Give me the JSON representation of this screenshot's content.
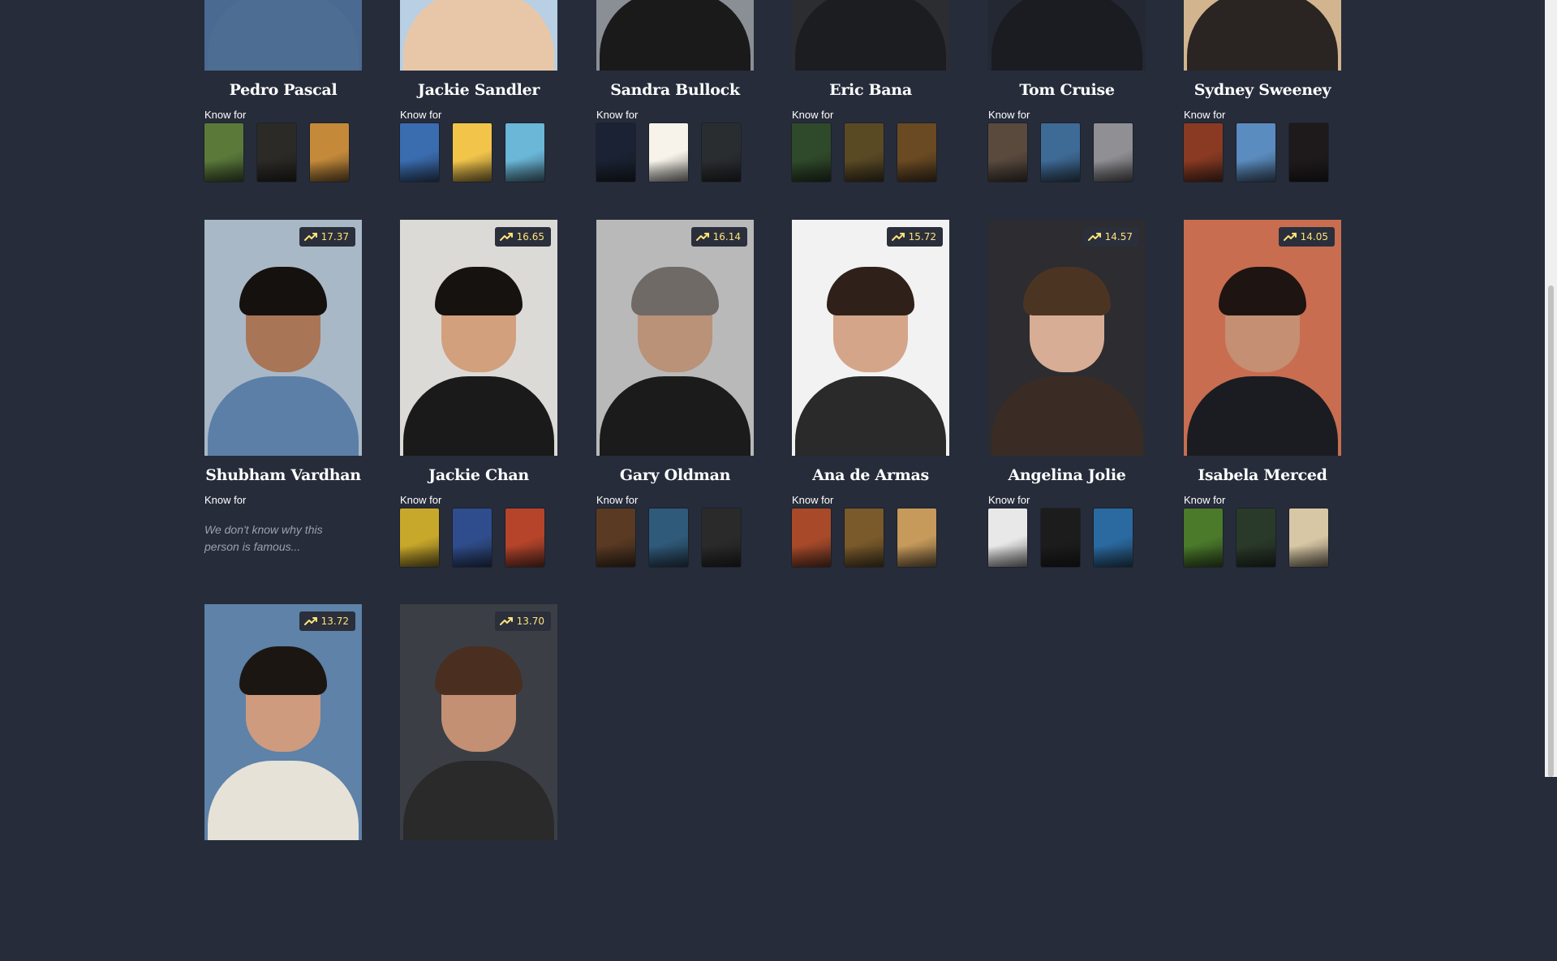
{
  "known_for_label": "Know for",
  "no_known_text": "We don't know why this person is famous...",
  "people": [
    {
      "name": "Pedro Pascal",
      "popularity": null,
      "photo": {
        "bg": "#4a6a92",
        "skin": "#c99a7b",
        "hair": "#1f1b18",
        "body": "#4d6d93"
      },
      "posters": [
        "#5b7a3a",
        "#2b2a26",
        "#c48a3a"
      ]
    },
    {
      "name": "Jackie Sandler",
      "popularity": null,
      "photo": {
        "bg": "#b8cfe4",
        "skin": "#e2b192",
        "hair": "#c6a27a",
        "body": "#e8c7a9"
      },
      "posters": [
        "#3a6cb0",
        "#f2c54a",
        "#6ab7d8"
      ]
    },
    {
      "name": "Sandra Bullock",
      "popularity": null,
      "photo": {
        "bg": "#8a8f95",
        "skin": "#d7ab8f",
        "hair": "#3e2a1e",
        "body": "#1a1a1a"
      },
      "posters": [
        "#1a2233",
        "#f7f3ea",
        "#2a2d30"
      ]
    },
    {
      "name": "Eric Bana",
      "popularity": null,
      "photo": {
        "bg": "#2b2d31",
        "skin": "#c59a7c",
        "hair": "#2a221d",
        "body": "#1c1d20"
      },
      "posters": [
        "#2f4a2a",
        "#5a4a24",
        "#6a4a22"
      ]
    },
    {
      "name": "Tom Cruise",
      "popularity": null,
      "photo": {
        "bg": "#232833",
        "skin": "#c79a7c",
        "hair": "#2a2420",
        "body": "#1a1c22"
      },
      "posters": [
        "#5a4a3e",
        "#3e6a96",
        "#8f8f94"
      ]
    },
    {
      "name": "Sydney Sweeney",
      "popularity": null,
      "photo": {
        "bg": "#d2b48f",
        "skin": "#e6bf9e",
        "hair": "#d7b27c",
        "body": "#2a2522"
      },
      "posters": [
        "#8a3a22",
        "#5b8cc0",
        "#1e1a1c"
      ]
    },
    {
      "name": "Shubham Vardhan",
      "popularity": "17.37",
      "photo": {
        "bg": "#a9b8c7",
        "skin": "#a97557",
        "hair": "#14110f",
        "body": "#5c7fa8"
      },
      "posters": []
    },
    {
      "name": "Jackie Chan",
      "popularity": "16.65",
      "photo": {
        "bg": "#dcdad7",
        "skin": "#d2a07c",
        "hair": "#16120f",
        "body": "#1a1a1a"
      },
      "posters": [
        "#c8a82a",
        "#2f4d8c",
        "#b5442a"
      ]
    },
    {
      "name": "Gary Oldman",
      "popularity": "16.14",
      "photo": {
        "bg": "#b9b9b9",
        "skin": "#b99278",
        "hair": "#6f6a66",
        "body": "#1b1b1b"
      },
      "posters": [
        "#5a3a22",
        "#2f5a7a",
        "#2a2a2a"
      ]
    },
    {
      "name": "Ana de Armas",
      "popularity": "15.72",
      "photo": {
        "bg": "#f2f2f2",
        "skin": "#d5a58a",
        "hair": "#2f211a",
        "body": "#2a2a2a"
      },
      "posters": [
        "#a84a2a",
        "#7a5a2a",
        "#c69a5a"
      ]
    },
    {
      "name": "Angelina Jolie",
      "popularity": "14.57",
      "photo": {
        "bg": "#2d2c30",
        "skin": "#d8ad95",
        "hair": "#4c3423",
        "body": "#3a2c24"
      },
      "posters": [
        "#e8e8e8",
        "#1c1c1c",
        "#2a6aa0"
      ]
    },
    {
      "name": "Isabela Merced",
      "popularity": "14.05",
      "photo": {
        "bg": "#c96d50",
        "skin": "#c48f72",
        "hair": "#1e1411",
        "body": "#1a1c22"
      },
      "posters": [
        "#4a7a2a",
        "#2a3a2a",
        "#d8c7a4"
      ]
    },
    {
      "name": "",
      "popularity": "13.72",
      "photo": {
        "bg": "#5e82a8",
        "skin": "#cf9b7e",
        "hair": "#1c1613",
        "body": "#e6e2d8"
      },
      "posters": []
    },
    {
      "name": "",
      "popularity": "13.70",
      "photo": {
        "bg": "#3b3f45",
        "skin": "#c39073",
        "hair": "#4a2e20",
        "body": "#2a2a2a"
      },
      "posters": []
    }
  ]
}
